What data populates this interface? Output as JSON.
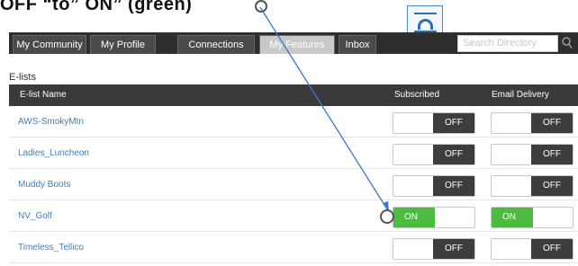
{
  "instruction": "OFF “to” ON” (green)",
  "nav": {
    "tabs": [
      "My Community",
      "My Profile",
      "Connections",
      "My Features",
      "Inbox"
    ],
    "active_tab": "My Features",
    "search_placeholder": "Search Directory"
  },
  "elists": {
    "section_title": "E-lists",
    "columns": [
      "E-list Name",
      "Subscribed",
      "Email Delivery"
    ],
    "rows": [
      {
        "name": "AWS-SmokyMtn",
        "subscribed": "OFF",
        "email_delivery": "OFF"
      },
      {
        "name": "Ladies_Luncheon",
        "subscribed": "OFF",
        "email_delivery": "OFF"
      },
      {
        "name": "Muddy Boots",
        "subscribed": "OFF",
        "email_delivery": "OFF"
      },
      {
        "name": "NV_Golf",
        "subscribed": "ON",
        "email_delivery": "ON"
      },
      {
        "name": "Timeless_Tellico",
        "subscribed": "OFF",
        "email_delivery": "OFF"
      }
    ]
  },
  "colors": {
    "on_green": "#4cbb3f",
    "off_dark": "#3d3d3d",
    "link_blue": "#3d7fc1",
    "arrow_blue": "#3b74d8"
  },
  "icons": [
    "document-icon",
    "search-icon"
  ]
}
